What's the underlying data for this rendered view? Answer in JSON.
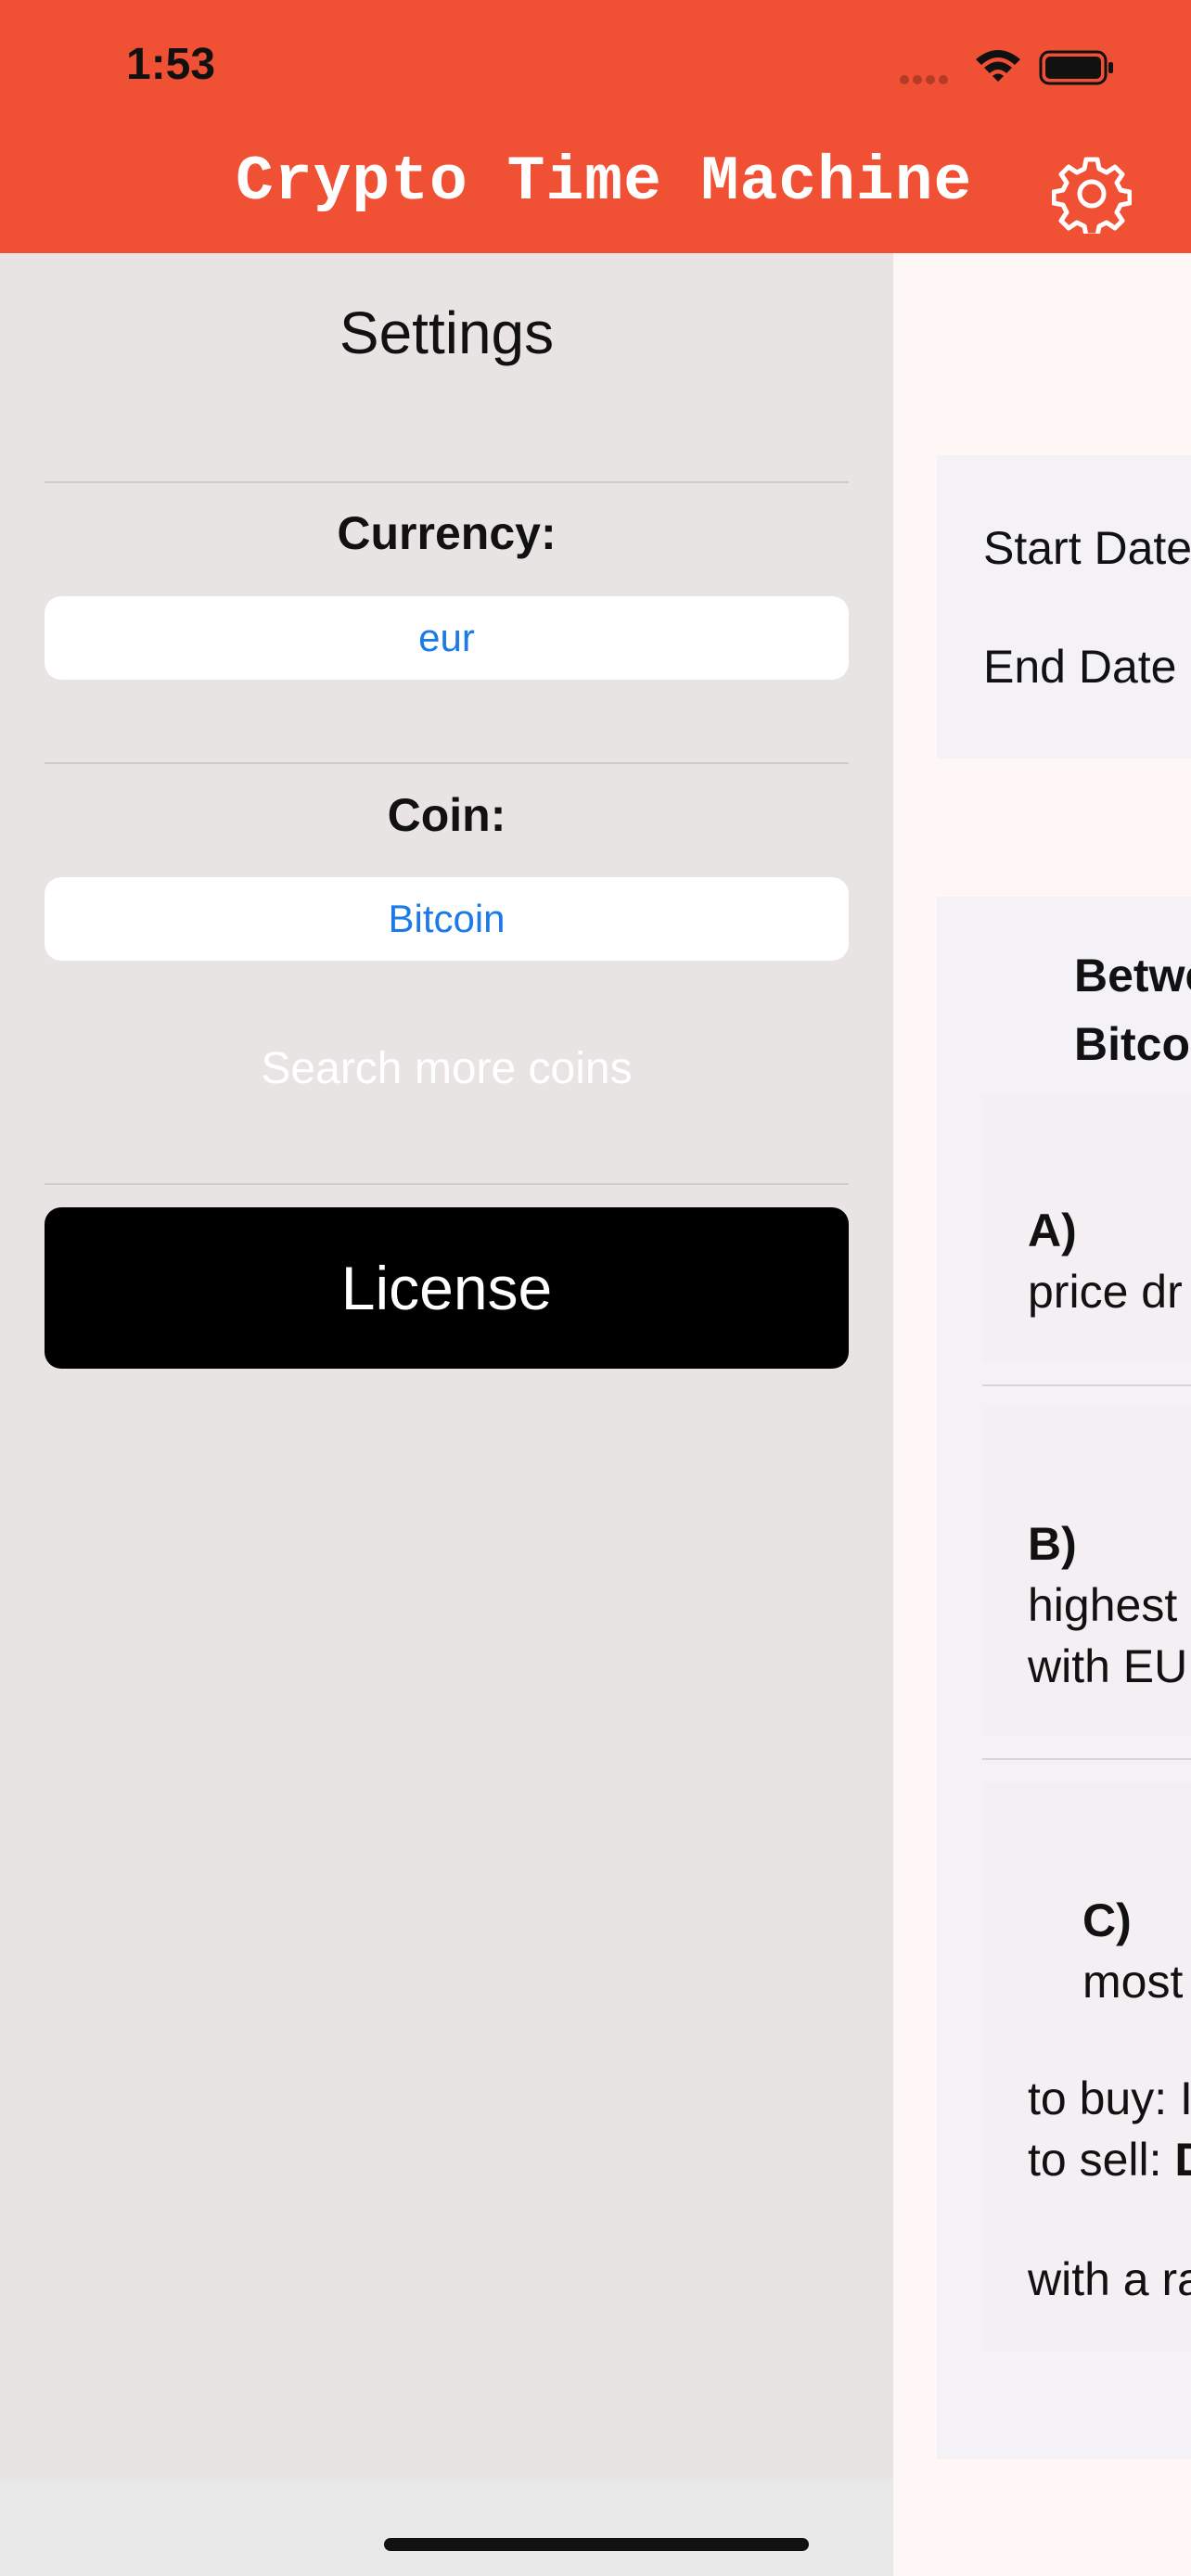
{
  "status_bar": {
    "time": "1:53"
  },
  "header": {
    "title": "Crypto Time Machine",
    "settings_icon": "gear-icon",
    "background": "#f05033"
  },
  "settings": {
    "title": "Settings",
    "currency_label": "Currency:",
    "currency_value": "eur",
    "coin_label": "Coin:",
    "coin_value": "Bitcoin",
    "search_more": "Search more coins",
    "license_button": "License"
  },
  "main": {
    "start_date_label": "Start Date",
    "end_date_label": "End Date",
    "between_line1": "Betwe",
    "between_line2": "Bitco",
    "option_a": {
      "label": "A)",
      "text": "price dr"
    },
    "option_b": {
      "label": "B)",
      "text_line1": "highest",
      "text_line2": "with EU"
    },
    "option_c": {
      "label": "C)",
      "text": "most",
      "buy": "to buy: I",
      "sell_prefix": "to sell: ",
      "sell_bold": "D",
      "with": "with a ra"
    }
  },
  "colors": {
    "accent": "#1b7ae6",
    "settings_bg": "#e7e4e3",
    "license_bg": "#000000"
  }
}
